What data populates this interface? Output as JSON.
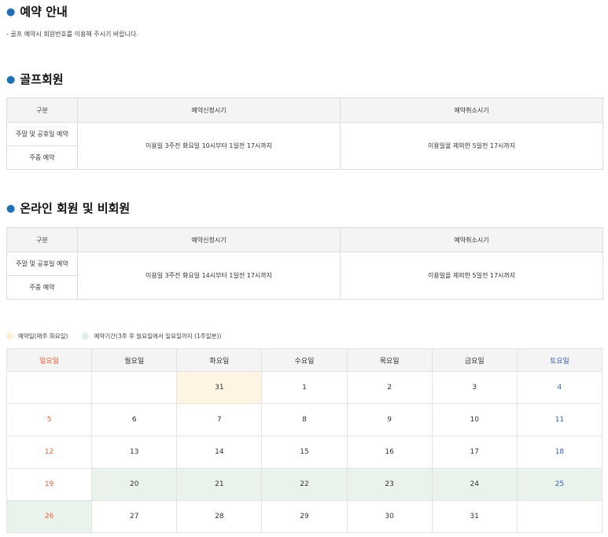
{
  "reservation_guide": {
    "title": "예약 안내",
    "note": "- 골프 예약시 회원번호를 이용해 주시기 바랍니다."
  },
  "golf_member": {
    "title": "골프회원",
    "headers": [
      "구분",
      "예약신청시기",
      "예약취소시기"
    ],
    "rows": [
      "주말 및 공휴일 예약",
      "주중 예약"
    ],
    "apply_period": "이용일 3주전 화요일 10시부터 1일전 17시까지",
    "cancel_period": "이용일을 제외한 5일전 17시까지"
  },
  "online_member": {
    "title": "온라인 회원 및 비회원",
    "headers": [
      "구분",
      "예약신청시기",
      "예약취소시기"
    ],
    "rows": [
      "주말 및 공휴일 예약",
      "주중 예약"
    ],
    "apply_period": "이용일 3주전 화요일 14시부터 1일전 17시까지",
    "cancel_period": "이용일을 제외한 5일전 17시까지"
  },
  "legend": {
    "reservation_day": "예약일(매주 화요일)",
    "reservation_period": "예약기간(3주 후 월요일에서 일요일까지 (1주일분))",
    "colors": {
      "reservation_day": "#fdf0d6",
      "reservation_period": "#dff0e4"
    }
  },
  "calendar": {
    "weekdays": [
      "일요일",
      "월요일",
      "화요일",
      "수요일",
      "목요일",
      "금요일",
      "토요일"
    ],
    "weeks": [
      [
        "",
        "",
        "31",
        "1",
        "2",
        "3",
        "4"
      ],
      [
        "5",
        "6",
        "7",
        "8",
        "9",
        "10",
        "11"
      ],
      [
        "12",
        "13",
        "14",
        "15",
        "16",
        "17",
        "18"
      ],
      [
        "19",
        "20",
        "21",
        "22",
        "23",
        "24",
        "25"
      ],
      [
        "26",
        "27",
        "28",
        "29",
        "30",
        "31",
        ""
      ]
    ],
    "highlight_reservation_day": [
      [
        0,
        2
      ]
    ],
    "highlight_reservation_period": [
      [
        3,
        1
      ],
      [
        3,
        2
      ],
      [
        3,
        3
      ],
      [
        3,
        4
      ],
      [
        3,
        5
      ],
      [
        3,
        6
      ],
      [
        4,
        0
      ]
    ]
  }
}
